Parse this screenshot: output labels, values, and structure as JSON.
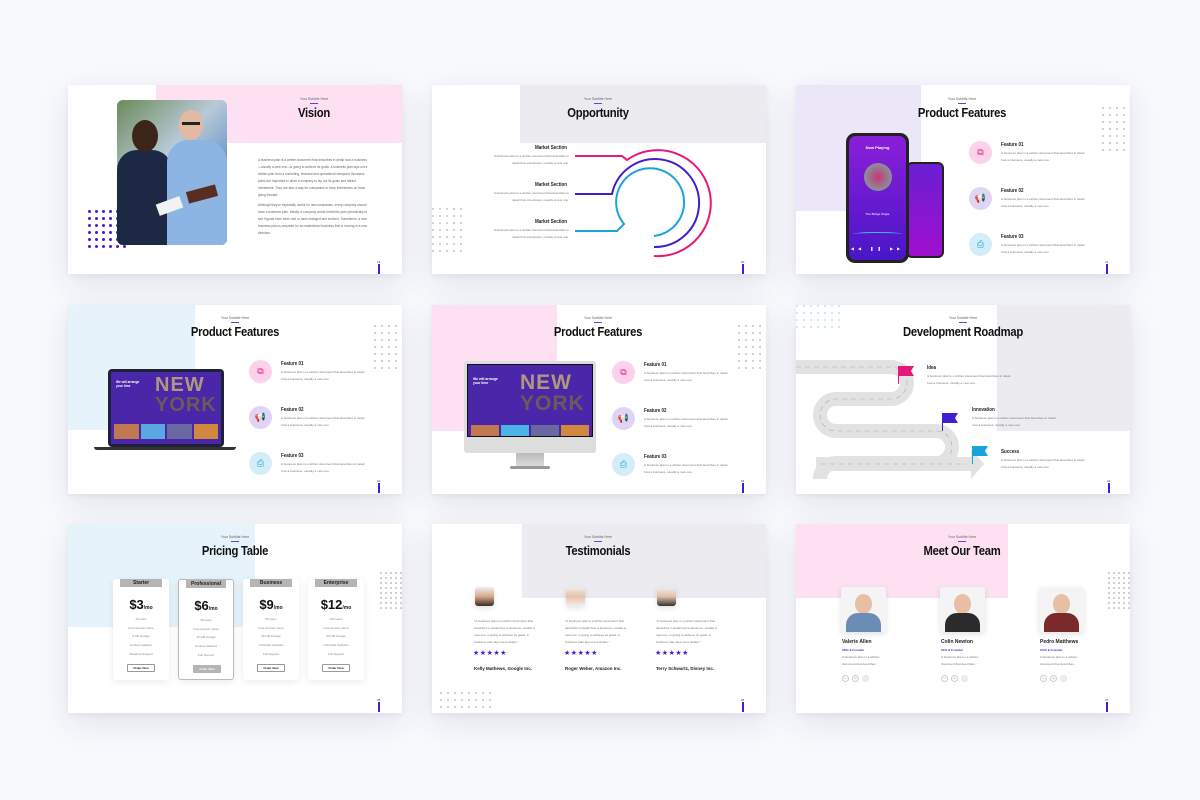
{
  "common": {
    "subtitle": "Your Subtitle Here"
  },
  "slides": {
    "vision": {
      "title": "Vision",
      "page": "19",
      "paragraph1": "A business plan is a written document that describes in detail how a business—usually a new one—is going to achieve its goals. A business plan lays out a written plan from a marketing, financial and operational viewpoint. Business plans are important to allow a company to lay out its goals and attract investment. They are also a way for companies to keep themselves on track going forward.",
      "paragraph2": "Although they're especially useful for new companies, every company should have a business plan. Ideally, a company would revisit the plan periodically to see if goals have been met or have changed and evolved. Sometimes, a new business plan is prepared for an established business that is moving in a new direction.",
      "image": "business-people-photo"
    },
    "opportunity": {
      "title": "Opportunity",
      "page": "20",
      "sections": [
        {
          "heading": "Market Section",
          "text": "A business plan is a written document that describes in detail how a business, usually a new one.",
          "color": "#e6187b"
        },
        {
          "heading": "Market Section",
          "text": "A business plan is a written document that describes in detail how a business, usually a new one.",
          "color": "#3f1fd1"
        },
        {
          "heading": "Market Section",
          "text": "A business plan is a written document that describes in detail how a business, usually a new one.",
          "color": "#1aa3d9"
        }
      ]
    },
    "features_phone": {
      "title": "Product Features",
      "page": "21",
      "phone_screen": {
        "heading": "Now Playing",
        "track": "The Bridge Single"
      },
      "features": [
        {
          "title": "Feature 01",
          "text": "A business plan is a written document that describes in detail how a business, usually a new one.",
          "icon": "cards-icon"
        },
        {
          "title": "Feature 02",
          "text": "A business plan is a written document that describes in detail how a business, usually a new one.",
          "icon": "megaphone-icon"
        },
        {
          "title": "Feature 03",
          "text": "A business plan is a written document that describes in detail how a business, usually a new one.",
          "icon": "printer-icon"
        }
      ]
    },
    "features_laptop": {
      "title": "Product Features",
      "page": "22",
      "screen": {
        "tagline": "We will arrange your time",
        "word1": "NEW",
        "word2": "YORK"
      },
      "features": [
        {
          "title": "Feature 01",
          "text": "A business plan is a written document that describes in detail how a business, usually a new one."
        },
        {
          "title": "Feature 02",
          "text": "A business plan is a written document that describes in detail how a business, usually a new one."
        },
        {
          "title": "Feature 03",
          "text": "A business plan is a written document that describes in detail how a business, usually a new one."
        }
      ]
    },
    "features_desktop": {
      "title": "Product Features",
      "page": "23",
      "screen": {
        "tagline": "We will arrange your time",
        "word1": "NEW",
        "word2": "YORK"
      },
      "features": [
        {
          "title": "Feature 01",
          "text": "A business plan is a written document that describes in detail how a business, usually a new one."
        },
        {
          "title": "Feature 02",
          "text": "A business plan is a written document that describes in detail how a business, usually a new one."
        },
        {
          "title": "Feature 03",
          "text": "A business plan is a written document that describes in detail how a business, usually a new one."
        }
      ]
    },
    "roadmap": {
      "title": "Development Roadmap",
      "page": "24",
      "steps": [
        {
          "title": "Idea",
          "text": "A business plan is a written document that describes in detail how a business, usually a new one.",
          "color": "#e6187b"
        },
        {
          "title": "Innovation",
          "text": "A business plan is a written document that describes in detail how a business, usually a new one.",
          "color": "#3f1fd1"
        },
        {
          "title": "Success",
          "text": "A business plan is a written document that describes in detail how a business, usually a new one.",
          "color": "#1aa3d9"
        }
      ]
    },
    "pricing": {
      "title": "Pricing Table",
      "page": "25",
      "plans": [
        {
          "name": "Starter",
          "price": "$3",
          "unit": "/mo",
          "features": [
            "10 users",
            "Free domain name",
            "5 GB storage",
            "Limited statistics",
            "Standard Support"
          ],
          "button": "Order Now",
          "highlighted": false
        },
        {
          "name": "Professional",
          "price": "$6",
          "unit": "/mo",
          "features": [
            "25 users",
            "Free domain name",
            "10 GB storage",
            "Limited statistics",
            "Full Support"
          ],
          "button": "Order Now",
          "highlighted": true
        },
        {
          "name": "Business",
          "price": "$9",
          "unit": "/mo",
          "features": [
            "50 users",
            "Free domain name",
            "30 GB storage",
            "Unlimited statistics",
            "Full Support"
          ],
          "button": "Order Now",
          "highlighted": false
        },
        {
          "name": "Enterprise",
          "price": "$12",
          "unit": "/mo",
          "features": [
            "100 users",
            "Free domain name",
            "50 GB storage",
            "Unlimited statistics",
            "Full Support"
          ],
          "button": "Order Now",
          "highlighted": false
        }
      ]
    },
    "testimonials": {
      "title": "Testimonials",
      "page": "26",
      "items": [
        {
          "quote": "\"A business plan is a written document that describes in detail how a business, usually a new one, is going to achieve its goals. A business plan lays out a written.\"",
          "rating": 5,
          "author": "Kelly Mathews, Google Inc."
        },
        {
          "quote": "\"A business plan is a written document that describes in detail how a business, usually a new one, is going to achieve its goals. A business plan lays out a written.\"",
          "rating": 5,
          "author": "Roger Weber, Amazon Inc."
        },
        {
          "quote": "\"A business plan is a written document that describes in detail how a business, usually a new one, is going to achieve its goals. A business plan lays out a written.\"",
          "rating": 5,
          "author": "Terry Schwartz, Disney Inc."
        }
      ]
    },
    "team": {
      "title": "Meet Our Team",
      "page": "27",
      "members": [
        {
          "name": "Valerie Allen",
          "role": "CEO & Founder",
          "text": "A business plan is a written document that describes."
        },
        {
          "name": "Colin Newton",
          "role": "CFO & Founder",
          "text": "A business plan is a written document that describes."
        },
        {
          "name": "Pedro Matthews",
          "role": "COO & Founder",
          "text": "A business plan is a written document that describes."
        }
      ],
      "social": [
        "in",
        "tw",
        ""
      ]
    }
  },
  "colors": {
    "accent": "#3f1fd1",
    "pink": "#e6187b",
    "cyan": "#1aa3d9",
    "pink_bg": "#fde1f2",
    "gray_bg": "#ebebf0",
    "lavender_bg": "#ebe6f8",
    "blue_bg": "#e6f3fa"
  }
}
